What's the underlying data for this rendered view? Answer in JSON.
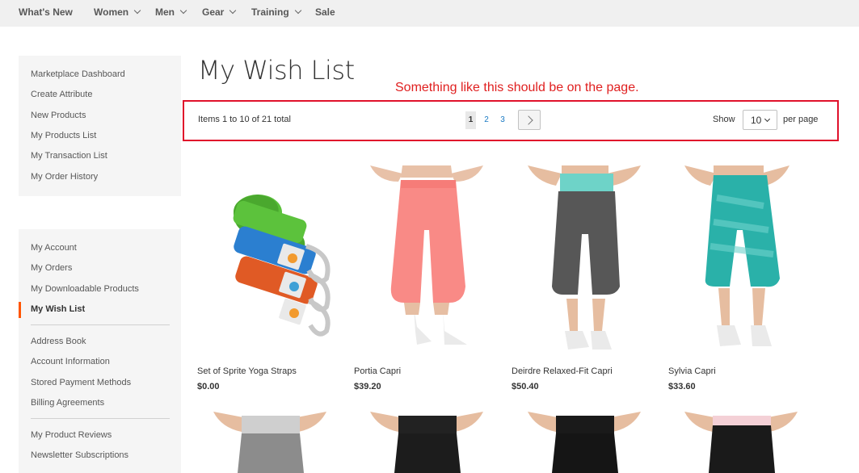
{
  "nav": {
    "items": [
      {
        "label": "What's New",
        "has_dropdown": false
      },
      {
        "label": "Women",
        "has_dropdown": true
      },
      {
        "label": "Men",
        "has_dropdown": true
      },
      {
        "label": "Gear",
        "has_dropdown": true
      },
      {
        "label": "Training",
        "has_dropdown": true
      },
      {
        "label": "Sale",
        "has_dropdown": false
      }
    ]
  },
  "sidebar_marketplace": {
    "items": [
      "Marketplace Dashboard",
      "Create Attribute",
      "New Products",
      "My Products List",
      "My Transaction List",
      "My Order History"
    ]
  },
  "sidebar_account": {
    "items": [
      "My Account",
      "My Orders",
      "My Downloadable Products",
      "My Wish List",
      "Address Book",
      "Account Information",
      "Stored Payment Methods",
      "Billing Agreements",
      "My Product Reviews",
      "Newsletter Subscriptions"
    ],
    "current": "My Wish List"
  },
  "page": {
    "title": "My Wish List",
    "annotation": "Something like this should be on the page."
  },
  "toolbar": {
    "amount": "Items 1 to 10 of 21 total",
    "pages": [
      "1",
      "2",
      "3"
    ],
    "current_page": "1",
    "show_label": "Show",
    "limit_value": "10",
    "per_page_label": "per page"
  },
  "products": [
    {
      "name": "Set of Sprite Yoga Straps",
      "price": "$0.00",
      "image": "yoga-straps"
    },
    {
      "name": "Portia Capri",
      "price": "$39.20",
      "image": "pink-capri"
    },
    {
      "name": "Deirdre Relaxed-Fit Capri",
      "price": "$50.40",
      "image": "gray-capri"
    },
    {
      "name": "Sylvia Capri",
      "price": "$33.60",
      "image": "teal-capri"
    }
  ],
  "colors": {
    "accent": "#ff5501",
    "link": "#1979c3",
    "annotation": "#e0112b"
  }
}
